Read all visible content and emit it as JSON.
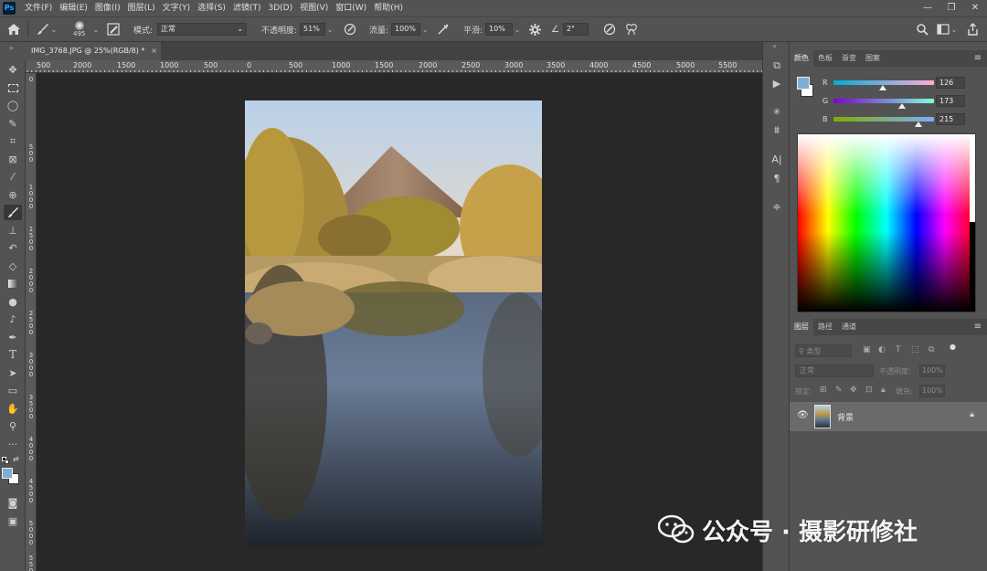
{
  "app": {
    "logo_text": "Ps"
  },
  "menu": {
    "items": [
      "文件(F)",
      "编辑(E)",
      "图像(I)",
      "图层(L)",
      "文字(Y)",
      "选择(S)",
      "滤镜(T)",
      "3D(D)",
      "视图(V)",
      "窗口(W)",
      "帮助(H)"
    ]
  },
  "options": {
    "brush_size": "495",
    "mode_label": "模式:",
    "mode_value": "正常",
    "opacity_label": "不透明度:",
    "opacity_value": "51%",
    "flow_label": "流量:",
    "flow_value": "100%",
    "smoothing_label": "平滑:",
    "smoothing_value": "10%",
    "angle_value": "2°"
  },
  "document": {
    "tab_title": "IMG_3768.JPG @ 25%(RGB/8) *",
    "close_glyph": "×"
  },
  "ruler": {
    "top_labels": [
      "500",
      "2000",
      "1500",
      "1000",
      "500",
      "0",
      "500",
      "1000",
      "1500",
      "2000",
      "2500",
      "3000",
      "3500",
      "4000",
      "4500",
      "5000",
      "5500"
    ],
    "left_labels": [
      "0",
      "5 0 0",
      "1 0 0 0",
      "1 5 0 0",
      "2 0 0 0",
      "2 5 0 0",
      "3 0 0 0",
      "3 5 0 0",
      "4 0 0 0",
      "4 5 0 0",
      "5 0 0 0",
      "5 5 0 0"
    ]
  },
  "color_panel": {
    "tabs": [
      "颜色",
      "色板",
      "渐变",
      "图案"
    ],
    "active_tab": "颜色",
    "foreground_color": "#7eadd7",
    "channels": [
      {
        "label": "R",
        "value": "126",
        "fraction": 0.494
      },
      {
        "label": "G",
        "value": "173",
        "fraction": 0.678
      },
      {
        "label": "B",
        "value": "215",
        "fraction": 0.843
      }
    ]
  },
  "layers_panel": {
    "tabs": [
      "图层",
      "路径",
      "通道"
    ],
    "active_tab": "图层",
    "filter_placeholder": "类型",
    "blend_mode": "正常",
    "opacity_label": "不透明度:",
    "opacity_value": "100%",
    "lock_label": "锁定:",
    "fill_label": "填充:",
    "fill_value": "100%",
    "layers": [
      {
        "name": "背景",
        "visible": true,
        "locked": true
      }
    ]
  },
  "watermark": {
    "text": "公众号 · 摄影研修社"
  }
}
